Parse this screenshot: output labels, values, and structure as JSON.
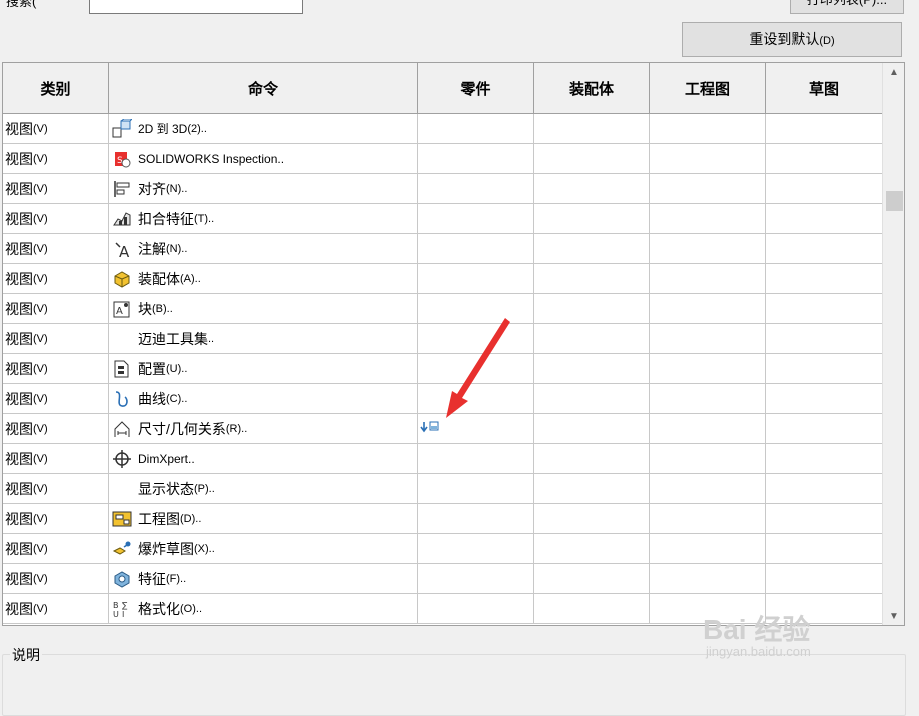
{
  "top": {
    "label": "搜索(",
    "print_button": "打印列表(P)..."
  },
  "reset_button": {
    "label": "重设到默认",
    "accel": "(D)"
  },
  "table": {
    "headers": [
      "类别",
      "命令",
      "零件",
      "装配体",
      "工程图",
      "草图"
    ],
    "rows": [
      {
        "category": "视图",
        "cat_accel": "(V)",
        "icon": "2d-to-3d-icon",
        "cmd_main": "",
        "cmd_latin": "2D 到 3D",
        "cmd_accel": "(2)..",
        "part_mark": ""
      },
      {
        "category": "视图",
        "cat_accel": "(V)",
        "icon": "inspection-icon",
        "cmd_main": "",
        "cmd_latin": "SOLIDWORKS Inspection..",
        "cmd_accel": "",
        "part_mark": ""
      },
      {
        "category": "视图",
        "cat_accel": "(V)",
        "icon": "align-icon",
        "cmd_main": "对齐",
        "cmd_latin": "",
        "cmd_accel": "(N)..",
        "part_mark": ""
      },
      {
        "category": "视图",
        "cat_accel": "(V)",
        "icon": "fastening-feature-icon",
        "cmd_main": "扣合特征",
        "cmd_latin": "",
        "cmd_accel": "(T)..",
        "part_mark": ""
      },
      {
        "category": "视图",
        "cat_accel": "(V)",
        "icon": "annotation-icon",
        "cmd_main": "注解",
        "cmd_latin": "",
        "cmd_accel": "(N)..",
        "part_mark": ""
      },
      {
        "category": "视图",
        "cat_accel": "(V)",
        "icon": "assembly-icon",
        "cmd_main": "装配体",
        "cmd_latin": "",
        "cmd_accel": "(A)..",
        "part_mark": ""
      },
      {
        "category": "视图",
        "cat_accel": "(V)",
        "icon": "block-icon",
        "cmd_main": "块",
        "cmd_latin": "",
        "cmd_accel": "(B)..",
        "part_mark": ""
      },
      {
        "category": "视图",
        "cat_accel": "(V)",
        "icon": "",
        "cmd_main": "迈迪工具集",
        "cmd_latin": "",
        "cmd_accel": "..",
        "part_mark": ""
      },
      {
        "category": "视图",
        "cat_accel": "(V)",
        "icon": "configuration-icon",
        "cmd_main": "配置",
        "cmd_latin": "",
        "cmd_accel": "(U)..",
        "part_mark": ""
      },
      {
        "category": "视图",
        "cat_accel": "(V)",
        "icon": "curve-icon",
        "cmd_main": "曲线",
        "cmd_latin": "",
        "cmd_accel": "(C)..",
        "part_mark": ""
      },
      {
        "category": "视图",
        "cat_accel": "(V)",
        "icon": "dimension-relation-icon",
        "cmd_main": "尺寸/几何关系",
        "cmd_latin": "",
        "cmd_accel": "(R)..",
        "part_mark": "shortcut-icon"
      },
      {
        "category": "视图",
        "cat_accel": "(V)",
        "icon": "dimxpert-icon",
        "cmd_main": "",
        "cmd_latin": "DimXpert..",
        "cmd_accel": "",
        "part_mark": ""
      },
      {
        "category": "视图",
        "cat_accel": "(V)",
        "icon": "",
        "cmd_main": "显示状态",
        "cmd_latin": "",
        "cmd_accel": "(P)..",
        "part_mark": ""
      },
      {
        "category": "视图",
        "cat_accel": "(V)",
        "icon": "drawing-icon",
        "cmd_main": "工程图",
        "cmd_latin": "",
        "cmd_accel": "(D)..",
        "part_mark": ""
      },
      {
        "category": "视图",
        "cat_accel": "(V)",
        "icon": "explode-sketch-icon",
        "cmd_main": "爆炸草图",
        "cmd_latin": "",
        "cmd_accel": "(X)..",
        "part_mark": ""
      },
      {
        "category": "视图",
        "cat_accel": "(V)",
        "icon": "features-icon",
        "cmd_main": "特征",
        "cmd_latin": "",
        "cmd_accel": "(F)..",
        "part_mark": ""
      },
      {
        "category": "视图",
        "cat_accel": "(V)",
        "icon": "format-icon",
        "cmd_main": "格式化",
        "cmd_latin": "",
        "cmd_accel": "(O)..",
        "part_mark": ""
      }
    ]
  },
  "description": {
    "label": "说明"
  },
  "watermark": {
    "brand": "Bai 经验",
    "url": "jingyan.baidu.com"
  },
  "colors": {
    "accent_red": "#e8302e",
    "icon_blue": "#2a6fb5"
  }
}
